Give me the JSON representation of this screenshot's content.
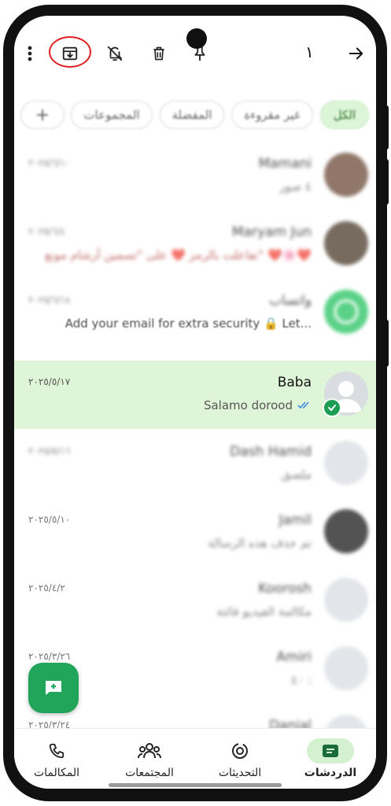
{
  "topbar": {
    "selected_count": "١",
    "icons": [
      "back-arrow-icon",
      "pin-icon",
      "delete-icon",
      "mute-icon",
      "archive-icon",
      "more-icon"
    ]
  },
  "filters": {
    "all": "الكل",
    "unread": "غير مقروءة",
    "favorites": "المفضلة",
    "groups": "المجموعات",
    "add": "+"
  },
  "chats": [
    {
      "name": "Mamani",
      "message": "٤ صور",
      "date": "٢٠٢٥/٦/١٠"
    },
    {
      "name": "Maryam Jun",
      "message": "تفاعلت بالرمز ❤️ على \"تسمين أرشام مونع\" ❤️🌸❤️",
      "date": "٢٠٢٥/٦/٤"
    },
    {
      "name": "واتساب",
      "message": "Add your email for extra security 🔒 Let...",
      "date": "٢٠٢٥/٦/١٨"
    },
    {
      "name": "Baba",
      "message": "Salamo dorood",
      "date": "٢٠٢٥/٥/١٧"
    },
    {
      "name": "Dash Hamid",
      "message": "ملصق",
      "date": "٢٠٢٥/٥/١٦"
    },
    {
      "name": "Jamil",
      "message": "تم حذف هذه الرسالة",
      "date": "٢٠٢٥/٥/١٠"
    },
    {
      "name": "Koorosh",
      "message": "مكالمة الفيديو فائتة",
      "date": "٢٠٢٥/٤/٢"
    },
    {
      "name": "Amiri",
      "message": "٤٠ :",
      "date": "٢٠٢٥/٣/٢٦"
    },
    {
      "name": "Danial",
      "message": "",
      "date": "٢٠٢٥/٣/٢٤"
    }
  ],
  "nav": {
    "chats": "الدردشات",
    "updates": "التحديثات",
    "communities": "المجتمعات",
    "calls": "المكالمات"
  },
  "colors": {
    "accent": "#21a55b",
    "selected_row": "#dff5d8",
    "highlight_ring": "#e02020"
  }
}
